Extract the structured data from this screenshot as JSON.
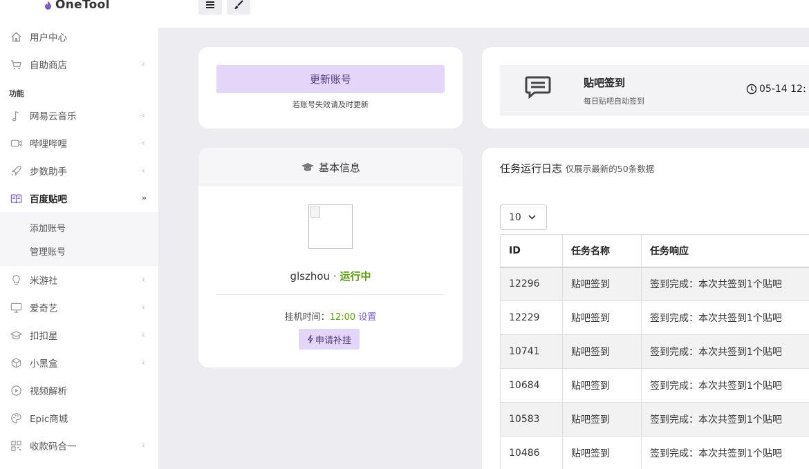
{
  "app": {
    "name": "OneTool"
  },
  "sidebar": {
    "items_top": [
      {
        "label": "用户中心",
        "icon": "home-icon",
        "arrow": false
      },
      {
        "label": "自助商店",
        "icon": "cart-icon",
        "arrow": true
      }
    ],
    "section_label": "功能",
    "items": [
      {
        "label": "网易云音乐",
        "icon": "music-note-icon",
        "arrow": true
      },
      {
        "label": "哔哩哔哩",
        "icon": "video-camera-icon",
        "arrow": true
      },
      {
        "label": "步数助手",
        "icon": "rocket-icon",
        "arrow": true
      },
      {
        "label": "百度贴吧",
        "icon": "book-icon",
        "arrow": true,
        "active": true
      }
    ],
    "submenu": [
      "添加账号",
      "管理账号"
    ],
    "items_bottom": [
      {
        "label": "米游社",
        "icon": "lightbulb-icon",
        "arrow": true
      },
      {
        "label": "爱奇艺",
        "icon": "monitor-icon",
        "arrow": true
      },
      {
        "label": "扣扣星",
        "icon": "graduation-cap-icon",
        "arrow": true
      },
      {
        "label": "小黑盒",
        "icon": "box-icon",
        "arrow": true
      },
      {
        "label": "视频解析",
        "icon": "play-circle-icon",
        "arrow": false
      },
      {
        "label": "Epic商城",
        "icon": "palette-icon",
        "arrow": false
      },
      {
        "label": "收款码合一",
        "icon": "qrcode-icon",
        "arrow": true
      }
    ]
  },
  "account_card": {
    "update_button": "更新账号",
    "update_note": "若账号失效请及时更新"
  },
  "sign_card": {
    "title": "贴吧签到",
    "subtitle": "每日贴吧自动签到",
    "time": "05-14 12:"
  },
  "info_card": {
    "title": "基本信息",
    "username": "glszhou",
    "separator": " · ",
    "status": "运行中",
    "hang_label": "挂机时间：",
    "hang_time": "12:00",
    "hang_setting": "设置",
    "apply_button": "申请补挂"
  },
  "log_card": {
    "title": "任务运行日志",
    "subtitle": "仅展示最新的50条数据",
    "page_size": "10",
    "columns": [
      "ID",
      "任务名称",
      "任务响应"
    ],
    "rows": [
      [
        "12296",
        "贴吧签到",
        "签到完成：本次共签到1个贴吧"
      ],
      [
        "12229",
        "贴吧签到",
        "签到完成：本次共签到1个贴吧"
      ],
      [
        "10741",
        "贴吧签到",
        "签到完成：本次共签到1个贴吧"
      ],
      [
        "10684",
        "贴吧签到",
        "签到完成：本次共签到1个贴吧"
      ],
      [
        "10583",
        "贴吧签到",
        "签到完成：本次共签到1个贴吧"
      ],
      [
        "10486",
        "贴吧签到",
        "签到完成：本次共签到1个贴吧"
      ]
    ]
  },
  "colors": {
    "accent": "#7c5cc4",
    "button_bg": "#e3d6f8",
    "running": "#5aa00a",
    "page_bg": "#ececf1"
  }
}
